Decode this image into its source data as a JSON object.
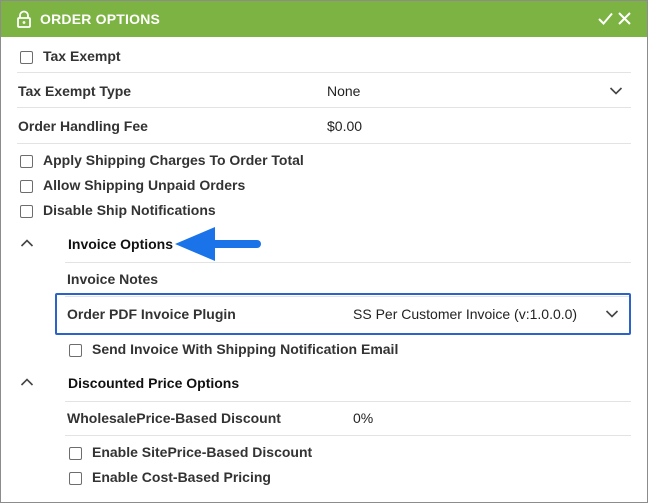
{
  "header": {
    "title": "ORDER OPTIONS",
    "bg_color": "#7cb342",
    "icons": {
      "lock": "lock-icon",
      "save": "check-icon",
      "close": "close-icon"
    }
  },
  "fields": {
    "tax_exempt": {
      "label": "Tax Exempt",
      "checked": false
    },
    "tax_exempt_type": {
      "label": "Tax Exempt Type",
      "value": "None"
    },
    "order_handling_fee": {
      "label": "Order Handling Fee",
      "value": "$0.00"
    },
    "apply_shipping_charges": {
      "label": "Apply Shipping Charges To Order Total",
      "checked": false
    },
    "allow_shipping_unpaid": {
      "label": "Allow Shipping Unpaid Orders",
      "checked": false
    },
    "disable_ship_notifications": {
      "label": "Disable Ship Notifications",
      "checked": false
    }
  },
  "invoice_options": {
    "title": "Invoice Options",
    "expanded": true,
    "invoice_notes_label": "Invoice Notes",
    "pdf_plugin": {
      "label": "Order PDF Invoice Plugin",
      "value": "SS Per Customer Invoice (v:1.0.0.0)"
    },
    "send_invoice": {
      "label": "Send Invoice With Shipping Notification Email",
      "checked": false
    }
  },
  "discounted_price_options": {
    "title": "Discounted Price Options",
    "expanded": true,
    "wholesale_discount": {
      "label": "WholesalePrice-Based Discount",
      "value": "0%"
    },
    "enable_siteprice": {
      "label": "Enable SitePrice-Based Discount",
      "checked": false
    },
    "enable_cost_pricing": {
      "label": "Enable Cost-Based Pricing",
      "checked": false
    }
  },
  "annotation": {
    "highlight_color": "#2b63c9",
    "arrow_color": "#1a73e8"
  }
}
